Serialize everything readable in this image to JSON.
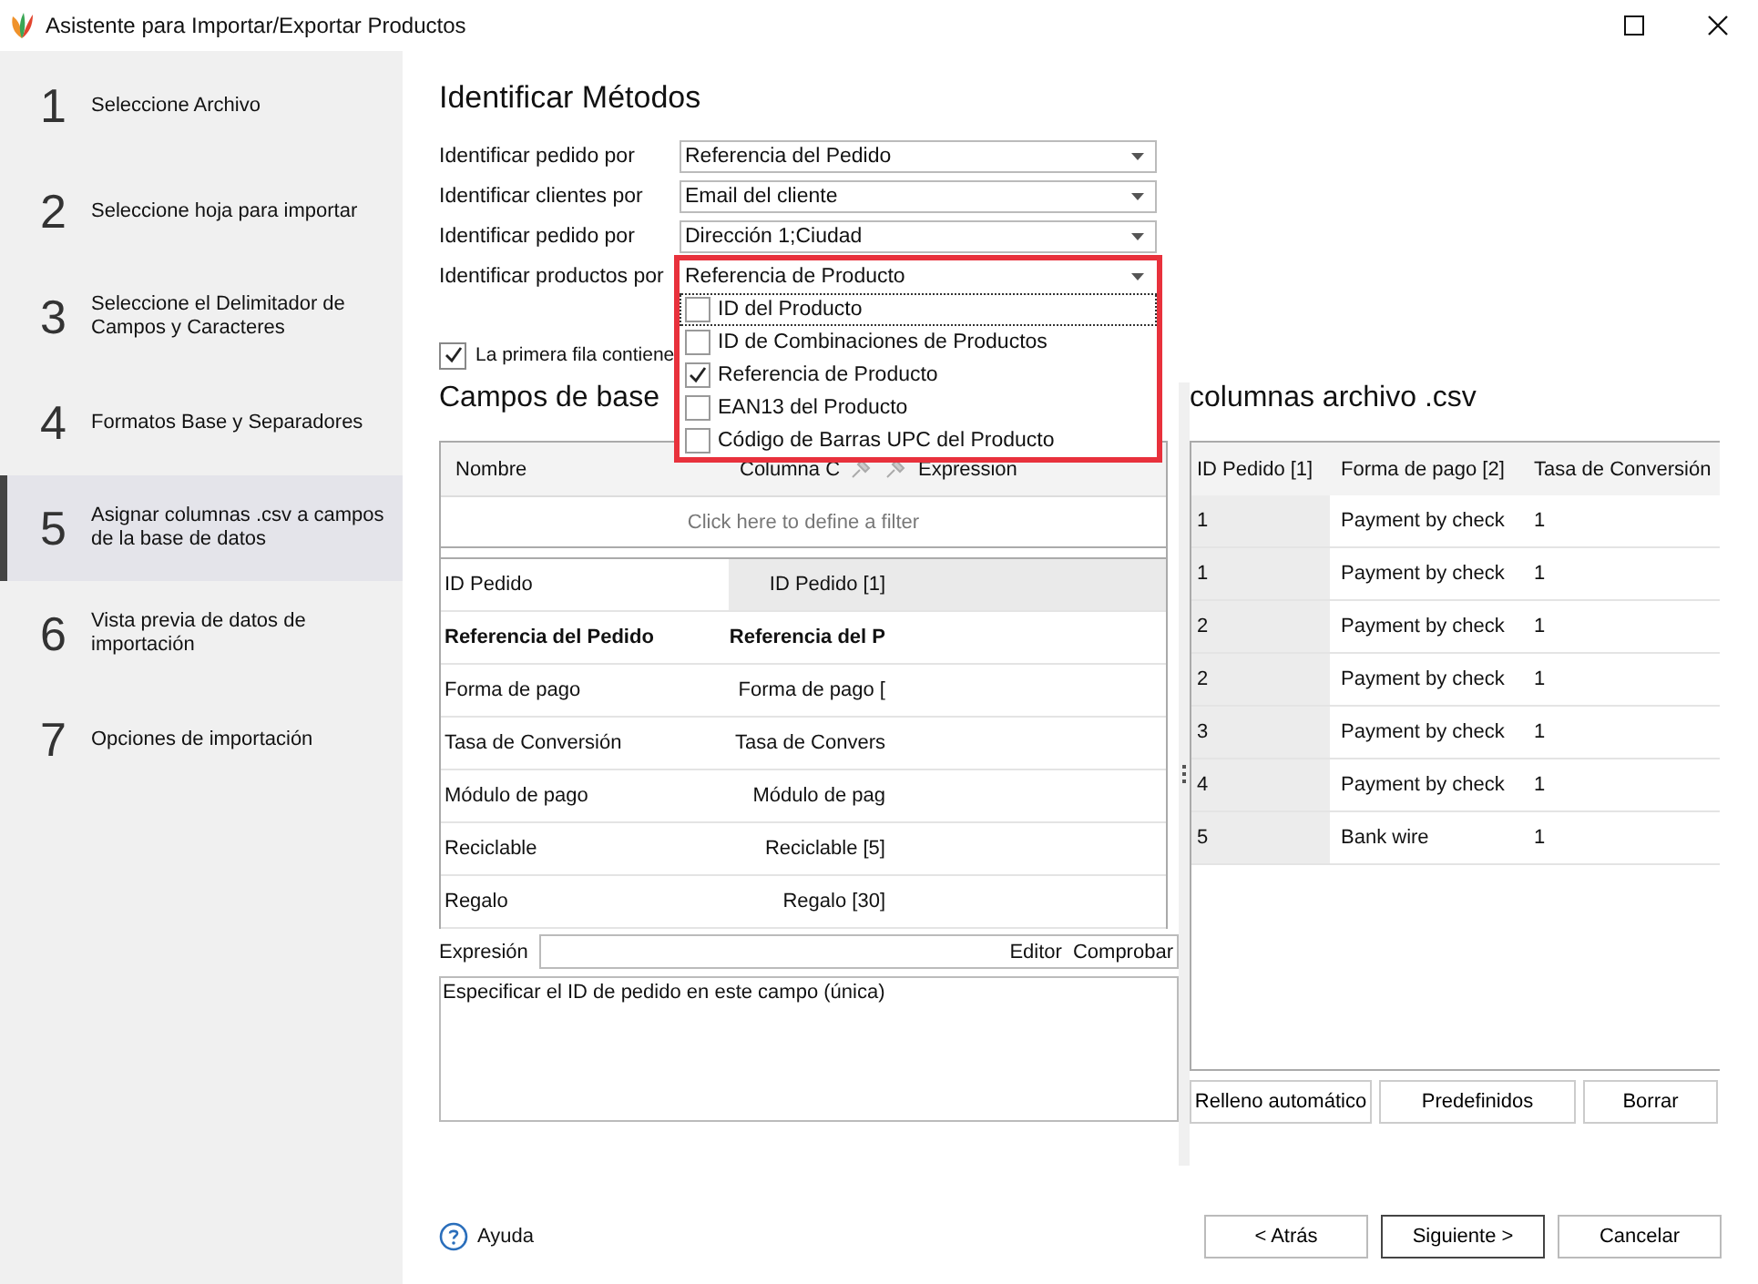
{
  "window": {
    "title": "Asistente para Importar/Exportar Productos"
  },
  "steps": [
    {
      "number": "1",
      "label": "Seleccione Archivo",
      "selected": false
    },
    {
      "number": "2",
      "label": "Seleccione hoja para importar",
      "selected": false
    },
    {
      "number": "3",
      "label": "Seleccione el Delimitador de Campos y Caracteres",
      "selected": false
    },
    {
      "number": "4",
      "label": "Formatos Base y Separadores",
      "selected": false
    },
    {
      "number": "5",
      "label": "Asignar columnas .csv a campos de la base de datos",
      "selected": true
    },
    {
      "number": "6",
      "label": "Vista previa de datos de importación",
      "selected": false
    },
    {
      "number": "7",
      "label": "Opciones de importación",
      "selected": false
    }
  ],
  "heading": "Identificar Métodos",
  "identifiers": [
    {
      "label": "Identificar pedido por",
      "value": "Referencia del Pedido",
      "highlighted": false
    },
    {
      "label": "Identificar clientes por",
      "value": "Email del cliente",
      "highlighted": false
    },
    {
      "label": "Identificar pedido por",
      "value": "Dirección 1;Ciudad",
      "highlighted": false
    },
    {
      "label": "Identificar productos por",
      "value": "Referencia de Producto",
      "highlighted": true,
      "options": [
        {
          "label": "ID del Producto",
          "checked": false,
          "focused": true
        },
        {
          "label": "ID de Combinaciones de Productos",
          "checked": false,
          "focused": false
        },
        {
          "label": "Referencia de Producto",
          "checked": true,
          "focused": false
        },
        {
          "label": "EAN13 del Producto",
          "checked": false,
          "focused": false
        },
        {
          "label": "Código de Barras UPC del Producto",
          "checked": false,
          "focused": false
        }
      ]
    }
  ],
  "header_row_option": {
    "label": "La primera fila contiene",
    "checked": true
  },
  "fields_panel": {
    "title": "Campos de base",
    "columns": [
      "Nombre",
      "Columna C",
      "Expression"
    ],
    "filter_hint": "Click here to define a filter",
    "rows": [
      {
        "name": "ID Pedido",
        "column": "ID Pedido [1]",
        "bold": false,
        "selected": true
      },
      {
        "name": "Referencia del Pedido",
        "column": "Referencia del P",
        "bold": true,
        "selected": false
      },
      {
        "name": "Forma de pago",
        "column": "Forma de pago [",
        "bold": false,
        "selected": false
      },
      {
        "name": "Tasa de Conversión",
        "column": "Tasa de Convers",
        "bold": false,
        "selected": false
      },
      {
        "name": "Módulo de pago",
        "column": "Módulo de pag",
        "bold": false,
        "selected": false
      },
      {
        "name": "Reciclable",
        "column": "Reciclable [5]",
        "bold": false,
        "selected": false
      },
      {
        "name": "Regalo",
        "column": "Regalo [30]",
        "bold": false,
        "selected": false
      }
    ],
    "expression_label": "Expresión",
    "expression_actions": [
      "Editor",
      "Comprobar"
    ],
    "description": "Especificar el ID de pedido en este campo (única)"
  },
  "csv_panel": {
    "title": "columnas archivo .csv",
    "columns": [
      "ID Pedido [1]",
      "Forma de pago [2]",
      "Tasa de Conversión"
    ],
    "rows": [
      [
        "1",
        "Payment by check",
        "1"
      ],
      [
        "1",
        "Payment by check",
        "1"
      ],
      [
        "2",
        "Payment by check",
        "1"
      ],
      [
        "2",
        "Payment by check",
        "1"
      ],
      [
        "3",
        "Payment by check",
        "1"
      ],
      [
        "4",
        "Payment by check",
        "1"
      ],
      [
        "5",
        "Bank wire",
        "1"
      ]
    ],
    "buttons": [
      "Relleno automático",
      "Predefinidos",
      "Borrar"
    ]
  },
  "help_link": "Ayuda",
  "footer_buttons": [
    {
      "label": "< Atrás",
      "default": false
    },
    {
      "label": "Siguiente >",
      "default": true
    },
    {
      "label": "Cancelar",
      "default": false
    }
  ]
}
